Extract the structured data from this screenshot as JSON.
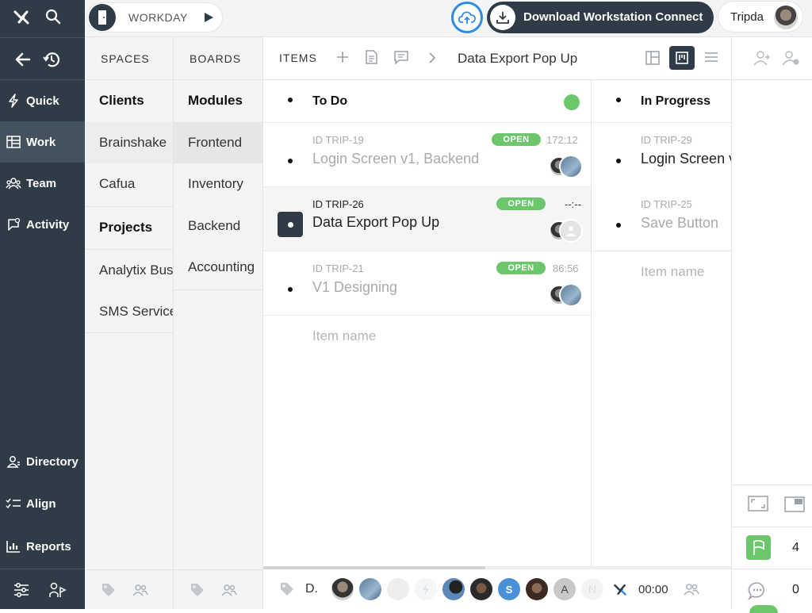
{
  "sidebar": {
    "items": [
      {
        "label": "Quick",
        "icon": "bolt-icon"
      },
      {
        "label": "Work",
        "icon": "grid-icon"
      },
      {
        "label": "Team",
        "icon": "team-icon"
      },
      {
        "label": "Activity",
        "icon": "activity-icon"
      }
    ],
    "bottom_items": [
      {
        "label": "Directory",
        "icon": "directory-icon"
      },
      {
        "label": "Align",
        "icon": "align-icon"
      },
      {
        "label": "Reports",
        "icon": "reports-icon"
      }
    ]
  },
  "topbar": {
    "workday_label": "WORKDAY",
    "download_label": "Download Workstation Connect",
    "user_name": "Tripda"
  },
  "spaces": {
    "header": "SPACES",
    "clients_heading": "Clients",
    "clients": [
      "Brainshake",
      "Cafua"
    ],
    "projects_heading": "Projects",
    "projects": [
      "Analytix Bus",
      "SMS Service"
    ]
  },
  "boards": {
    "header": "BOARDS",
    "heading": "Modules",
    "items": [
      "Frontend",
      "Inventory",
      "Backend",
      "Accounting"
    ]
  },
  "items": {
    "header": "ITEMS",
    "breadcrumb_current": "Data Export Pop Up"
  },
  "board": {
    "todo": {
      "title": "To Do",
      "cards": [
        {
          "id": "ID TRIP-19",
          "title": "Login Screen v1, Backend",
          "badge": "OPEN",
          "time": "172:12"
        },
        {
          "id": "ID TRIP-26",
          "title": "Data Export Pop Up",
          "badge": "OPEN",
          "time": "--:--"
        },
        {
          "id": "ID TRIP-21",
          "title": "V1 Designing",
          "badge": "OPEN",
          "time": "86:56"
        }
      ],
      "placeholder": "Item name"
    },
    "in_progress": {
      "title": "In Progress",
      "cards": [
        {
          "id": "ID TRIP-29",
          "title": "Login Screen v"
        },
        {
          "id": "ID TRIP-25",
          "title": "Save Button"
        }
      ],
      "placeholder": "Item name"
    }
  },
  "bottombar": {
    "label": "D.",
    "avatar_letters": [
      "A",
      "N"
    ],
    "timer": "00:00"
  },
  "rpanel": {
    "flag_count": "4",
    "comment_count": "0"
  },
  "colors": {
    "sidebar_bg": "#2f3b47",
    "sidebar_active": "#44525f",
    "badge_green": "#6cc76c",
    "accent_blue": "#2b8de6"
  }
}
